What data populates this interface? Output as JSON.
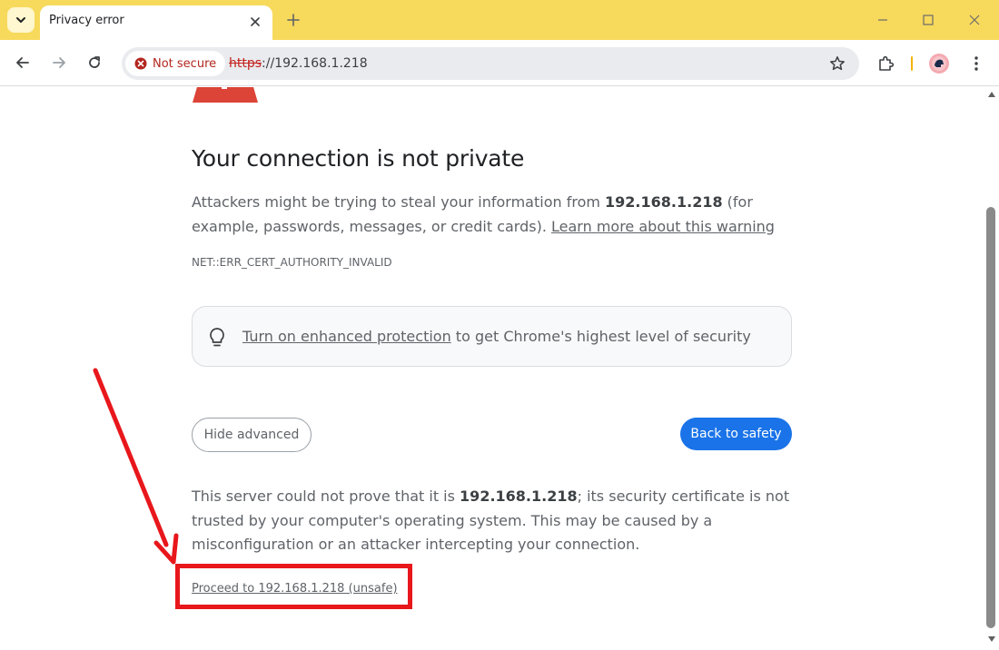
{
  "tab": {
    "title": "Privacy error"
  },
  "omnibox": {
    "security_chip": "Not secure",
    "url_scheme": "https",
    "url_rest": "://192.168.1.218"
  },
  "page": {
    "title": "Your connection is not private",
    "intro_prefix": "Attackers might be trying to steal your information from ",
    "intro_host": "192.168.1.218",
    "intro_suffix": " (for example, passwords, messages, or credit cards). ",
    "learn_more": "Learn more about this warning",
    "error_code": "NET::ERR_CERT_AUTHORITY_INVALID",
    "enhanced_link": "Turn on enhanced protection",
    "enhanced_suffix": " to get Chrome's highest level of security",
    "hide_advanced": "Hide advanced",
    "back_to_safety": "Back to safety",
    "details_prefix": "This server could not prove that it is ",
    "details_host": "192.168.1.218",
    "details_suffix": "; its security certificate is not trusted by your computer's operating system. This may be caused by a misconfiguration or an attacker intercepting your connection.",
    "proceed_link": "Proceed to 192.168.1.218 (unsafe)"
  },
  "colors": {
    "tabstrip": "#f7d95c",
    "primary_button": "#1a73e8",
    "warning_red": "#db4437",
    "annotation_red": "#e8171c"
  },
  "icons": [
    "tab-search-icon",
    "close-icon",
    "plus-icon",
    "minimize-icon",
    "maximize-icon",
    "window-close-icon",
    "back-arrow-icon",
    "forward-arrow-icon",
    "reload-icon",
    "not-secure-icon",
    "star-icon",
    "extensions-icon",
    "profile-avatar-icon",
    "kebab-menu-icon",
    "warning-triangle-icon",
    "lightbulb-icon",
    "red-arrow-annotation"
  ]
}
